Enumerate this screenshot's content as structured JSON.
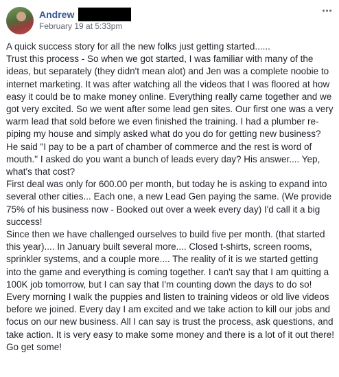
{
  "post": {
    "author": "Andrew",
    "timestamp": "February 19 at 5:33pm",
    "paragraphs": [
      "A quick success story for all the new folks just getting started......",
      "Trust this process - So when we got started, I was familiar with many of the ideas, but separately (they didn't mean alot) and Jen was a complete noobie to internet marketing. It was after watching all the videos that I was floored at how easy it could be to make money online. Everything really came together and we got very excited. So we went after some lead gen sites. Our first one was a very warm lead that sold before we even finished the training. I had a plumber re-piping my house and simply asked what do you do for getting new business? He said \"I pay to be a part of chamber of commerce and the rest is word of mouth.\" I asked do you want a bunch of leads every day? His answer.... Yep, what's that cost?",
      "First deal was only for 600.00 per month, but today he is asking to expand into several other cities... Each one, a new Lead Gen paying the same. (We provide 75% of his business now - Booked out over a week every day) I'd call it a big success!",
      "Since then we have challenged ourselves to build five per month. (that started this year).... In January built several more.... Closed t-shirts, screen rooms, sprinkler systems, and a couple more.... The reality of it is we started getting into the game and everything is coming together. I can't say that I am quitting a 100K job tomorrow, but I can say that I'm counting down the days to do so! Every morning I walk the puppies and listen to training videos or old live videos before we joined. Every day I am excited and we take action to kill our jobs and focus on our new business. All I can say is trust the process, ask questions, and take action. It is very easy to make some money and there is a lot of it out there! Go get some!"
    ]
  },
  "icons": {
    "more": "more-options-icon",
    "avatar": "profile-photo"
  },
  "colors": {
    "author_link": "#385898",
    "meta": "#616770",
    "text": "#1d2129"
  }
}
